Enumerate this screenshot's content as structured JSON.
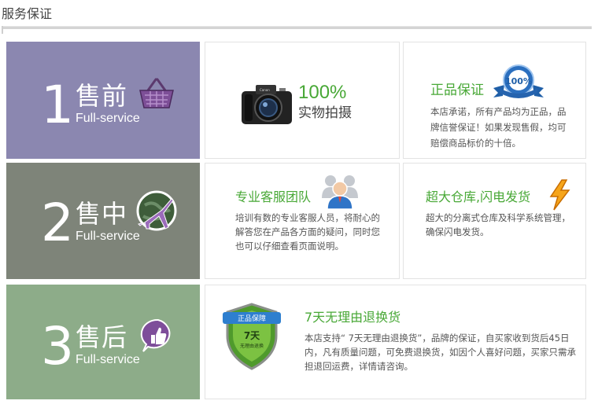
{
  "header": {
    "title": "服务保证"
  },
  "stages": [
    {
      "number": "1",
      "name": "售前",
      "sub": "Full-service",
      "color": "#8b87b0",
      "icon": "shopping-basket-icon"
    },
    {
      "number": "2",
      "name": "售中",
      "sub": "Full-service",
      "color": "#7e8479",
      "icon": "airplane-globe-icon"
    },
    {
      "number": "3",
      "name": "售后",
      "sub": "Full-service",
      "color": "#8dac89",
      "icon": "thumbs-up-chat-icon"
    }
  ],
  "cards": {
    "photo": {
      "percent": "100%",
      "label": "实物拍摄",
      "icon": "camera-icon"
    },
    "genuine": {
      "title": "正品保证",
      "text": "本店承诺，所有产品均为正品，品牌信誉保证！如果发现售假，均可赔偿商品标价的十倍。",
      "badge": "100%",
      "icon": "certificate-badge-icon"
    },
    "service": {
      "title": "专业客服团队",
      "text": "培训有数的专业客服人员，将耐心的解答您在产品各方面的疑问，同时您也可以仔细查看页面说明。",
      "icon": "team-people-icon"
    },
    "warehouse": {
      "title": "超大仓库,闪电发货",
      "text": "超大的分离式仓库及科学系统管理，确保闪电发货。",
      "icon": "lightning-icon"
    },
    "returns": {
      "title": "7天无理由退换货",
      "text": "本店支持“ 7天无理由退换货”，品牌的保证，自买家收到货后45日内，凡有质量问题，可免费退换货，如因个人喜好问题，买家只需承担退回运费，详情请咨询。",
      "shield_ribbon": "正品保障",
      "shield_big": "7天",
      "shield_small": "无理由退换",
      "icon": "shield-guarantee-icon"
    }
  },
  "colors": {
    "accent_green": "#48a836",
    "stage1": "#8b87b0",
    "stage2": "#7e8479",
    "stage3": "#8dac89"
  }
}
